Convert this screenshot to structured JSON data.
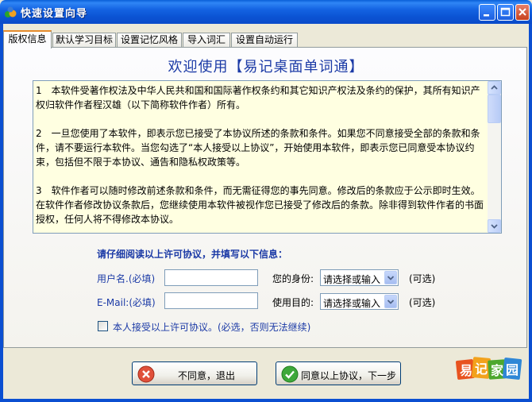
{
  "window": {
    "title": "快速设置向导"
  },
  "tabs": [
    {
      "label": "版权信息",
      "active": true
    },
    {
      "label": "默认学习目标"
    },
    {
      "label": "设置记忆风格"
    },
    {
      "label": "导入词汇"
    },
    {
      "label": "设置自动运行"
    }
  ],
  "welcome": "欢迎使用【易记桌面单词通】",
  "license": {
    "p1": "1　本软件受著作权法及中华人民共和国和国际著作权条约和其它知识产权法及条约的保护，其所有知识产权归软件作者程汉雄（以下简称软件作者）所有。",
    "p2": "2　一旦您使用了本软件，即表示您已接受了本协议所述的条款和条件。如果您不同意接受全部的条款和条件，请不要运行本软件。当您勾选了“本人接受以上协议”，开始使用本软件，即表示您已同意受本协议约束，包括但不限于本协议、通告和隐私权政策等。",
    "p3": "3　软件作者可以随时修改前述条款和条件，而无需征得您的事先同意。修改后的条款应于公示即时生效。在软件作者修改协议条款后，您继续使用本软件被视作您已接受了修改后的条款。除非得到软件作者的书面授权，任何人将不得修改本协议。"
  },
  "form": {
    "instruction": "请仔细阅读以上许可协议，并填写以下信息：",
    "username_label": "用户名.(必填)",
    "username_value": "",
    "email_label": "E-Mail:(必填)",
    "email_value": "",
    "identity_label": "您的身份:",
    "identity_value": "请选择或输入",
    "purpose_label": "使用目的:",
    "purpose_value": "请选择或输入",
    "optional1": "(可选)",
    "optional2": "(可选)",
    "accept_label": "本人接受以上许可协议。(必选，否则无法继续)",
    "accept_checked": false
  },
  "buttons": {
    "decline": "不同意，退出",
    "accept": "同意以上协议，下一步"
  },
  "logo": {
    "text": "易记家园"
  }
}
